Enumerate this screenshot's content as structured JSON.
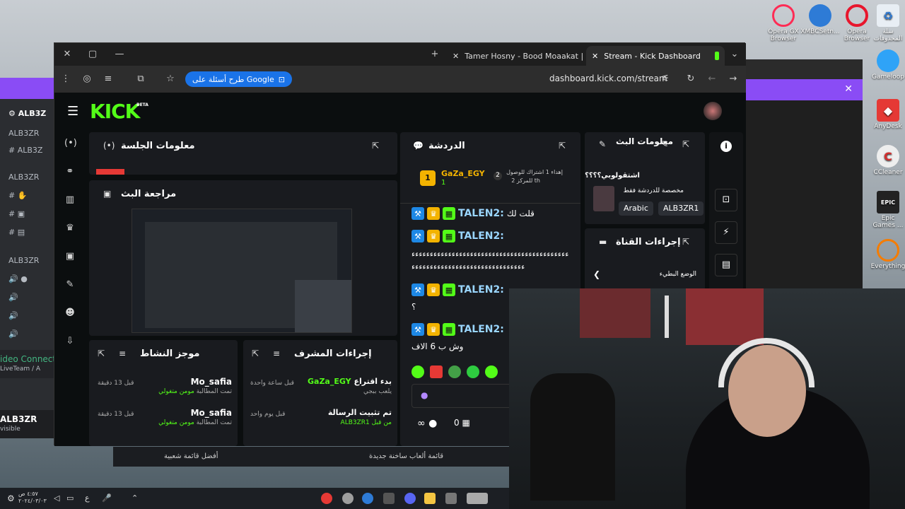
{
  "desktop": {
    "icons": [
      {
        "label": "Opera GX",
        "sub": "Browser",
        "glyph_color": "#ff2c55"
      },
      {
        "label": "XMBCSetn...",
        "sub": "",
        "glyph_color": "#2e7bd6"
      },
      {
        "label": "Opera",
        "sub": "Browser",
        "glyph_color": "#e8162d"
      },
      {
        "label": "سلة",
        "sub": "المحذوفات",
        "glyph_color": "#7fb6e6"
      },
      {
        "label": "Gameloop",
        "sub": "",
        "glyph_color": "#2fa3f7"
      },
      {
        "label": "AnyDesk",
        "sub": "",
        "glyph_color": "#e53935"
      },
      {
        "label": "CCleaner",
        "sub": "",
        "glyph_color": "#d8d8d8"
      },
      {
        "label": "Epic",
        "sub": "Games ...",
        "glyph_color": "#222"
      },
      {
        "label": "Everything",
        "sub": "",
        "glyph_color": "#f57c00"
      }
    ]
  },
  "discord": {
    "server_name": "ALB3Z",
    "lines": [
      "ALB3ZR",
      "ALB3Z",
      "ALB3ZR",
      "ALB3ZR"
    ],
    "voice_status": "ideo Connect",
    "voice_channel": "LiveTeam / A",
    "user_name": "ALB3ZR",
    "user_status": "visible"
  },
  "browser": {
    "tabs": [
      {
        "title": "Tamer Hosny - Bood Moaakat |"
      },
      {
        "title": "Stream - Kick Dashboard"
      }
    ],
    "google_pill": "طرح أسئلة على Google",
    "url": "dashboard.kick.com/stream"
  },
  "kick": {
    "logo": "KICK",
    "beta": "BETA",
    "session": {
      "title": "معلومات الجلسة"
    },
    "preview": {
      "title": "مراجعة البث"
    },
    "chat": {
      "title": "الدردشة",
      "pinned_user": "GaZa_EGY",
      "pinned_count": "1",
      "pinned_text": "إهداء 1 اشتراك للوصول",
      "pinned_text2": "للمركز 2 th",
      "pinned_num": "2",
      "messages": [
        {
          "user": "TALEN2:",
          "text": "قلت لك"
        },
        {
          "user": "TALEN2:",
          "text": "ءءءءءءءءءءءءءءءءءءءءءءءءءءءءءءءءءءءءءءءءءءءءءءءءءءءءءءءءءءءءءءءءءءءءءءءءءء"
        },
        {
          "user": "TALEN2:",
          "text": "؟"
        },
        {
          "user": "TALEN2:",
          "text": "وش ب 6 الاف"
        }
      ],
      "viewers": "∞",
      "zero": "0"
    },
    "stream_info": {
      "title": "معلومات البث",
      "stream_title": "اشتقولوبي؟؟؟؟",
      "category": "مخصصة للدردشة فقط",
      "tags": [
        "Arabic",
        "ALB3ZR1"
      ]
    },
    "channel_actions": {
      "title": "إجراءات القناة",
      "item": "الوضع البطيء"
    },
    "activity": {
      "title": "موجز النشاط",
      "items": [
        {
          "user": "Mo_safia",
          "time": "قبل 13 دقيقة",
          "sub": "تمت المطالبة",
          "reward": "مومن متغولي"
        },
        {
          "user": "Mo_safia",
          "time": "قبل 13 دقيقة",
          "sub": "تمت المطالبة",
          "reward": "مومن متغولي"
        }
      ]
    },
    "mod_actions": {
      "title": "إجراءات المشرف",
      "items": [
        {
          "user": "GaZa_EGY",
          "action": "بدء اقتراع",
          "time": "قبل ساعة واحدة",
          "sub": "يلعب ببجي"
        },
        {
          "user": "",
          "action": "تم تثبيت الرسالة",
          "time": "قبل يوم واحد",
          "sub": "ALB3ZR1 من قبل"
        }
      ]
    }
  },
  "bottom_strip": {
    "left": "أفضل قائمة شعبية",
    "right": "قائمة ألعاب ساخنة جديدة"
  },
  "taskbar": {
    "time": "٤:٥٧ ص",
    "date": "٢٠٢٤/٠٣/٠٣",
    "lang": "ع"
  }
}
